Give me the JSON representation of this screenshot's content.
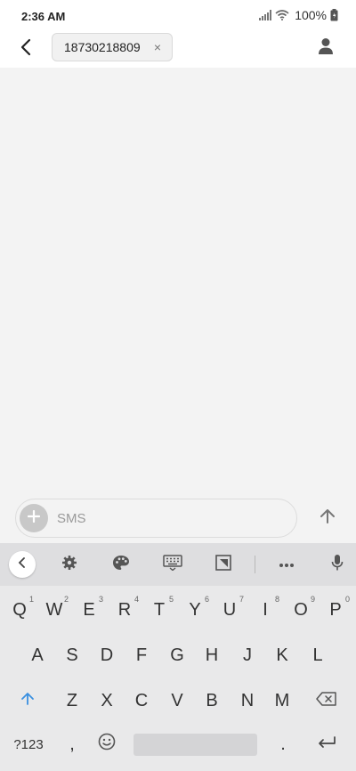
{
  "status_bar": {
    "time": "2:36 AM",
    "battery": "100%",
    "icons": [
      "signal-icon",
      "wifi-icon",
      "battery-icon"
    ]
  },
  "header": {
    "recipient": "18730218809",
    "chip_close": "×",
    "icons": [
      "back-arrow-icon",
      "contact-icon"
    ]
  },
  "composer": {
    "placeholder": "SMS",
    "icons": [
      "plus-icon",
      "send-arrow-icon"
    ]
  },
  "keyboard": {
    "toolbar_icons": [
      "chevron-left-icon",
      "gear-icon",
      "palette-icon",
      "keyboard-icon",
      "resize-icon",
      "more-icon",
      "mic-icon"
    ],
    "row1": [
      {
        "key": "Q",
        "hint": "1"
      },
      {
        "key": "W",
        "hint": "2"
      },
      {
        "key": "E",
        "hint": "3"
      },
      {
        "key": "R",
        "hint": "4"
      },
      {
        "key": "T",
        "hint": "5"
      },
      {
        "key": "Y",
        "hint": "6"
      },
      {
        "key": "U",
        "hint": "7"
      },
      {
        "key": "I",
        "hint": "8"
      },
      {
        "key": "O",
        "hint": "9"
      },
      {
        "key": "P",
        "hint": "0"
      }
    ],
    "row2": [
      "A",
      "S",
      "D",
      "F",
      "G",
      "H",
      "J",
      "K",
      "L"
    ],
    "row3": [
      "Z",
      "X",
      "C",
      "V",
      "B",
      "N",
      "M"
    ],
    "row4": {
      "symbols": "?123",
      "comma": ",",
      "period": "."
    }
  },
  "colors": {
    "accent": "#3a90e0",
    "background": "#f3f3f3",
    "keyboard_bg": "#e9e9ea"
  }
}
